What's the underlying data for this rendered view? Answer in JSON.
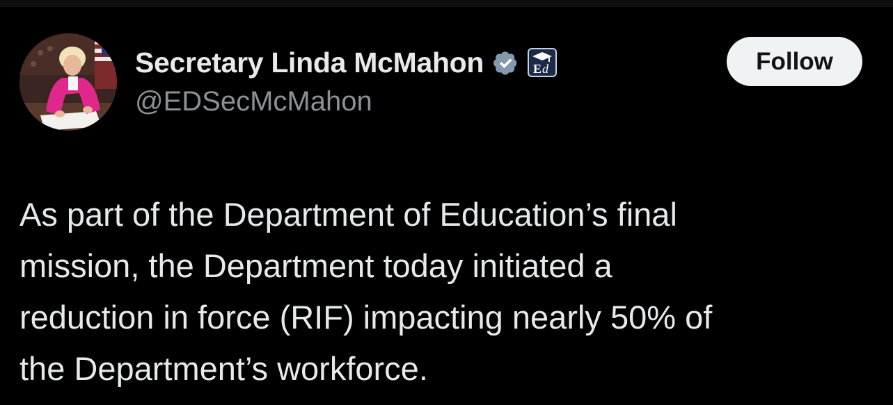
{
  "author": {
    "display_name": "Secretary Linda McMahon",
    "handle": "@EDSecMcMahon",
    "verified_icon": "verified-badge-icon",
    "affiliation_icon": "department-of-education-badge-icon"
  },
  "actions": {
    "follow_label": "Follow"
  },
  "tweet": {
    "lines": [
      "As part of the Department of Education’s final",
      "mission, the Department today initiated a",
      "reduction in force (RIF) impacting nearly 50% of",
      "the Department’s workforce."
    ]
  },
  "colors": {
    "background": "#000000",
    "text": "#e7e9ea",
    "secondary_text": "#8b9196",
    "button_bg": "#eff3f4",
    "button_text": "#0f1419",
    "verified": "#829aab"
  }
}
